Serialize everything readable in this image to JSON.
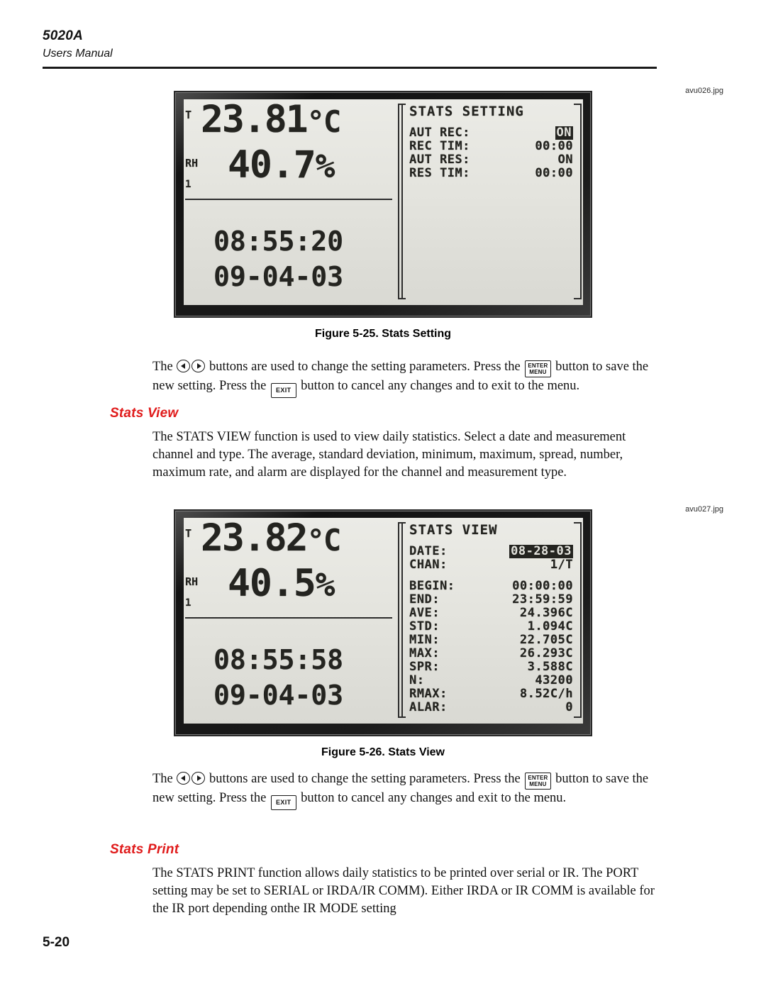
{
  "header": {
    "model": "5020A",
    "subtitle": "Users Manual"
  },
  "figures": [
    {
      "caption": "Figure 5-25. Stats Setting",
      "asset_label": "avu026.jpg",
      "lcd": {
        "tag_t": "T",
        "tag_rh": "RH",
        "tag_channel": "1",
        "temperature": "23.81",
        "temperature_unit": "°C",
        "humidity": "40.7",
        "humidity_unit": "%",
        "time": "08:55:20",
        "date": "09-04-03",
        "panel_title": "STATS SETTING",
        "rows": [
          {
            "key": "AUT REC:",
            "value": "ON",
            "highlighted": true
          },
          {
            "key": "REC TIM:",
            "value": "00:00",
            "highlighted": false
          },
          {
            "key": "AUT RES:",
            "value": "ON",
            "highlighted": false
          },
          {
            "key": "RES TIM:",
            "value": "00:00",
            "highlighted": false
          }
        ]
      }
    },
    {
      "caption": "Figure 5-26. Stats View",
      "asset_label": "avu027.jpg",
      "lcd": {
        "tag_t": "T",
        "tag_rh": "RH",
        "tag_channel": "1",
        "temperature": "23.82",
        "temperature_unit": "°C",
        "humidity": "40.5",
        "humidity_unit": "%",
        "time": "08:55:58",
        "date": "09-04-03",
        "panel_title": "STATS VIEW",
        "rows": [
          {
            "key": "DATE:",
            "value": "08-28-03",
            "highlighted": true
          },
          {
            "key": "CHAN:",
            "value": "1/T",
            "highlighted": false
          }
        ],
        "rows2": [
          {
            "key": "BEGIN:",
            "value": "00:00:00"
          },
          {
            "key": "END:",
            "value": "23:59:59"
          },
          {
            "key": "AVE:",
            "value": "24.396C"
          },
          {
            "key": "STD:",
            "value": "1.094C"
          },
          {
            "key": "MIN:",
            "value": "22.705C"
          },
          {
            "key": "MAX:",
            "value": "26.293C"
          },
          {
            "key": "SPR:",
            "value": "3.588C"
          },
          {
            "key": "N:",
            "value": "43200"
          },
          {
            "key": "RMAX:",
            "value": "8.52C/h"
          },
          {
            "key": "ALAR:",
            "value": "0"
          }
        ]
      }
    }
  ],
  "keys": {
    "enter_menu_line1": "ENTER",
    "enter_menu_line2": "MENU",
    "exit": "EXIT"
  },
  "body": {
    "para1_a": "The ",
    "para1_b": " buttons are used to change the setting parameters. Press the ",
    "para1_c": " button to save the new setting. Press the ",
    "para1_d": " button to cancel any changes and to exit to the menu.",
    "para3_a": "The ",
    "para3_b": " buttons are used to change the setting parameters. Press the ",
    "para3_c": " button to save the new setting. Press the ",
    "para3_d": " button  to cancel any changes and exit to the menu."
  },
  "sections": [
    {
      "heading": "Stats View",
      "paragraph": "The STATS VIEW function is used to view daily statistics. Select a date and measurement channel and type. The average, standard deviation, minimum, maximum, spread, number, maximum rate, and alarm are displayed for the channel and measurement type."
    },
    {
      "heading": "Stats Print",
      "paragraph": "The STATS PRINT function allows daily statistics to be printed over serial or IR. The PORT setting may be set to SERIAL or IRDA/IR COMM). Either IRDA or IR COMM is available for the IR port depending onthe IR MODE setting"
    }
  ],
  "footer": {
    "page_number": "5-20"
  },
  "colors": {
    "heading_red": "#e01b1b",
    "lcd_screen": "#e2e2dc",
    "lcd_ink": "#262622"
  }
}
